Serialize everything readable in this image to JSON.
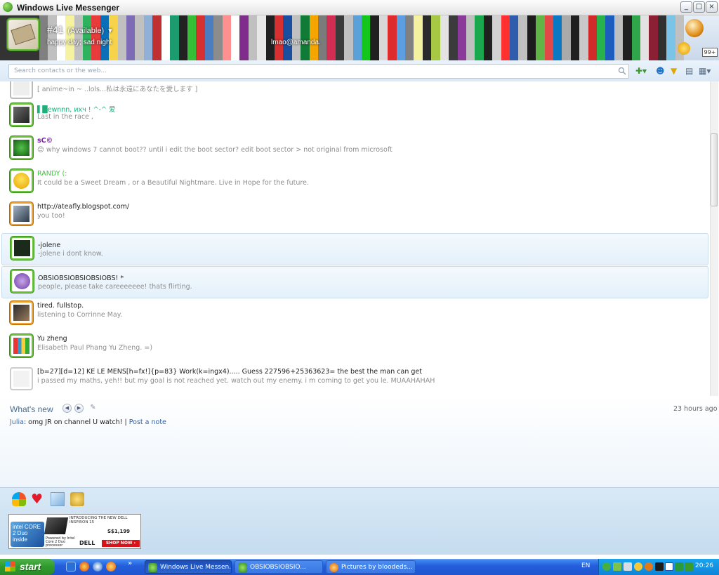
{
  "window": {
    "title": "Windows Live Messenger",
    "buttons": [
      "_",
      "□",
      "×"
    ]
  },
  "header": {
    "display_name": "#41",
    "status": "(Available)",
    "personal_message": "happy day; sad night",
    "email_text": "lmao@amanda.",
    "mail_count": "99+",
    "stripe_colors": [
      "#808080",
      "#c0c0c0",
      "#ffffff",
      "#f5f3a0",
      "#c0c0c0",
      "#2db25d",
      "#e83c3c",
      "#0b6fb8",
      "#f7d34a",
      "#c0c0c0",
      "#7e6bb5",
      "#c0c0c0",
      "#91b0d8",
      "#c03030",
      "#ffffff",
      "#1b9b6e",
      "#222222",
      "#36bf36",
      "#d63030",
      "#4a7ec0",
      "#8c8c8c",
      "#ff9090",
      "#ffffff",
      "#7f2c8c",
      "#c0c0c0",
      "#e7e7e7",
      "#202020",
      "#d73030",
      "#1a4f9f",
      "#c0c0c0",
      "#0f7b36",
      "#f5a500",
      "#7b7b7b",
      "#d42d52",
      "#3a3a3a",
      "#c0c0c0",
      "#5ba1d9",
      "#12c61b",
      "#202020",
      "#d8d8d8",
      "#de2c2c",
      "#5c9ee0",
      "#808080",
      "#f4f1a0",
      "#2a2a2a",
      "#a6c845",
      "#e3e3e3",
      "#3b3b3b",
      "#8b3a9a",
      "#c0c0c0",
      "#1aa84f",
      "#202020",
      "#d1d1d1",
      "#ff3030",
      "#2e5dae",
      "#c0c0c0",
      "#1c1c1c",
      "#63b446",
      "#e24848",
      "#0a79c2",
      "#aaaaaa",
      "#202020",
      "#c9c9c9",
      "#d12a2a",
      "#27b24b",
      "#1c5dbd",
      "#c0c0c0",
      "#202020",
      "#2fa64a",
      "#e2e2e2",
      "#8b1f34",
      "#303030",
      "#7bc4e8",
      "#c0c0c0"
    ]
  },
  "search": {
    "placeholder": "Search contacts or the web..."
  },
  "contacts": [
    {
      "name": "[ anime~in ~ ..lols...私は永遠にあなたを愛します ]",
      "message": "",
      "status": "online",
      "name_color": "#8e8e8e"
    },
    {
      "name": "▌█ewnnn, ихч ! ^-^    爱",
      "message": "Last in the race ,",
      "status": "online",
      "name_color": "#1fae7a"
    },
    {
      "name": "sC©",
      "message": "😊 why windows 7 cannot boot?? until i edit the boot sector? edit boot sector > not original from microsoft",
      "status": "online",
      "name_color": "#7a1fa2"
    },
    {
      "name": "RANDY (:",
      "message": "It could be a Sweet Dream , or a Beautiful Nightmare.    Live in Hope for the future.",
      "status": "online",
      "name_color": "#3fc43f"
    },
    {
      "name": "http://ateafly.blogspot.com/",
      "message": "you too!",
      "status": "away",
      "name_color": "#222222"
    },
    {
      "name": "-jolene",
      "message": "-jolene                                                                              i dont know.",
      "status": "online",
      "name_color": "#222222"
    },
    {
      "name": "OBSIOBSIOBSIOBSIOBS! *",
      "message": "people, please take careeeeeee!                                          thats flirting.",
      "status": "online",
      "name_color": "#222222"
    },
    {
      "name": "tired. fullstop.",
      "message": "listening to Corrinne May.",
      "status": "away",
      "name_color": "#222222"
    },
    {
      "name": "Yu zheng",
      "message": "Elisabeth Paul Phang Yu Zheng. =)",
      "status": "online",
      "name_color": "#222222"
    },
    {
      "name": "[b=27][d=12] KE LE MENS[h=fx!]{p=83} Work(k=ingx4)..... Guess 227596+25363623= the best the man can get",
      "message": "i passed my maths, yeh!! but my goal is not reached yet. watch out my enemy. i m coming to get you le. MUAAHAHAH",
      "status": "offline",
      "name_color": "#222222"
    }
  ],
  "whats_new": {
    "title": "What's new",
    "time": "23 hours ago",
    "author": "Julia",
    "text": ": omg JR on channel U watch! |",
    "post_link": "Post a note"
  },
  "ad": {
    "intel_label": "intel CORE 2 Duo inside",
    "headline": "INTRODUCING THE NEW DELL INSPIRON 15",
    "price": "S$1,199",
    "powered": "Powered by Intel Core 2 Duo processor",
    "brand": "DELL",
    "cta": "SHOP NOW ›"
  },
  "taskbar": {
    "start_label": "start",
    "tasks": [
      "Windows Live Messen...",
      "OBSIOBSIOBSIO...",
      "Pictures by bloodeds..."
    ],
    "lang": "EN",
    "clock": "20:26"
  }
}
